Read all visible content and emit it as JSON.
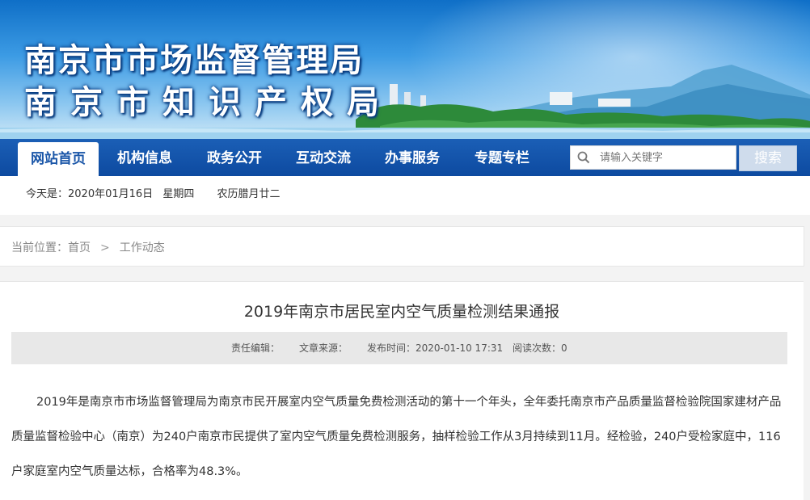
{
  "banner": {
    "title_line1": "南京市市场监督管理局",
    "title_line2": "南京市知识产权局"
  },
  "nav": {
    "items": [
      "网站首页",
      "机构信息",
      "政务公开",
      "互动交流",
      "办事服务",
      "专题专栏"
    ],
    "active_index": 0,
    "search_placeholder": "请输入关键字",
    "search_button": "搜索",
    "date_label": "今天是：2020年01月16日",
    "weekday": "星期四",
    "lunar": "农历腊月廿二"
  },
  "breadcrumb": {
    "prefix": "当前位置：首页",
    "separator": ">",
    "current": "工作动态"
  },
  "article": {
    "title": "2019年南京市居民室内空气质量检测结果通报",
    "meta": {
      "editor": "责任编辑：",
      "source": "文章来源：",
      "published": "发布时间：2020-01-10 17:31",
      "views": "阅读次数：0"
    },
    "body": "2019年是南京市市场监督管理局为南京市民开展室内空气质量免费检测活动的第十一个年头，全年委托南京市产品质量监督检验院国家建材产品质量监督检验中心（南京）为240户南京市民提供了室内空气质量免费检测服务，抽样检验工作从3月持续到11月。经检验，240户受检家庭中，116户家庭室内空气质量达标，合格率为48.3%。"
  },
  "colors": {
    "nav_blue": "#1b5fb6",
    "active_text": "#1a56a8"
  }
}
